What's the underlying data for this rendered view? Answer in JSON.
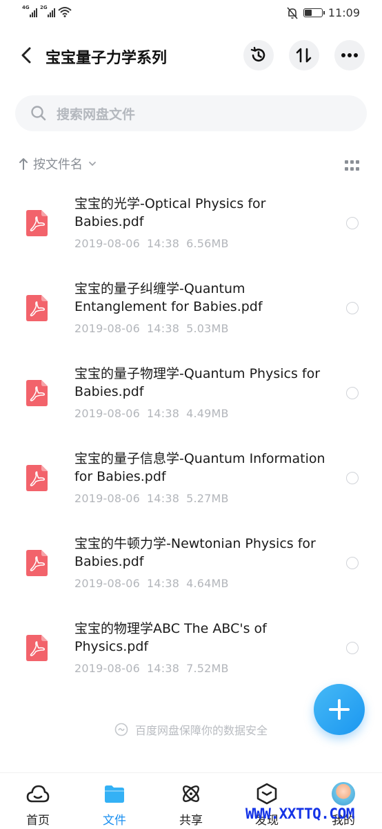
{
  "status_bar": {
    "signal_1": "4G",
    "signal_2": "2G",
    "time": "11:09",
    "battery_level": 0.4
  },
  "header": {
    "title": "宝宝量子力学系列",
    "icons": [
      "back-arrow-icon",
      "history-icon",
      "transfer-icon",
      "more-icon"
    ]
  },
  "search": {
    "placeholder": "搜索网盘文件"
  },
  "sort": {
    "label": "按文件名"
  },
  "files": [
    {
      "name": "宝宝的光学-Optical Physics for Babies.pdf",
      "date": "2019-08-06",
      "time": "14:38",
      "size": "6.56MB"
    },
    {
      "name": "宝宝的量子纠缠学-Quantum Entanglement for Babies.pdf",
      "date": "2019-08-06",
      "time": "14:38",
      "size": "5.03MB"
    },
    {
      "name": "宝宝的量子物理学-Quantum Physics for Babies.pdf",
      "date": "2019-08-06",
      "time": "14:38",
      "size": "4.49MB"
    },
    {
      "name": "宝宝的量子信息学-Quantum Information for Babies.pdf",
      "date": "2019-08-06",
      "time": "14:38",
      "size": "5.27MB"
    },
    {
      "name": "宝宝的牛顿力学-Newtonian Physics for Babies.pdf",
      "date": "2019-08-06",
      "time": "14:38",
      "size": "4.64MB"
    },
    {
      "name": "宝宝的物理学ABC The ABC's of Physics.pdf",
      "date": "2019-08-06",
      "time": "14:38",
      "size": "7.52MB"
    }
  ],
  "safety_note": "百度网盘保障你的数据安全",
  "bottom_nav": {
    "items": [
      {
        "label": "首页",
        "icon": "cloud-home-icon"
      },
      {
        "label": "文件",
        "icon": "folder-icon",
        "active": true
      },
      {
        "label": "共享",
        "icon": "share-atom-icon"
      },
      {
        "label": "发现",
        "icon": "cube-icon"
      },
      {
        "label": "我的",
        "icon": "avatar"
      }
    ]
  },
  "watermark": "WWW.XXTTQ.COM",
  "colors": {
    "accent": "#1a8ff0",
    "pdf_red": "#f2636b",
    "text_secondary": "#b3b6bb"
  }
}
